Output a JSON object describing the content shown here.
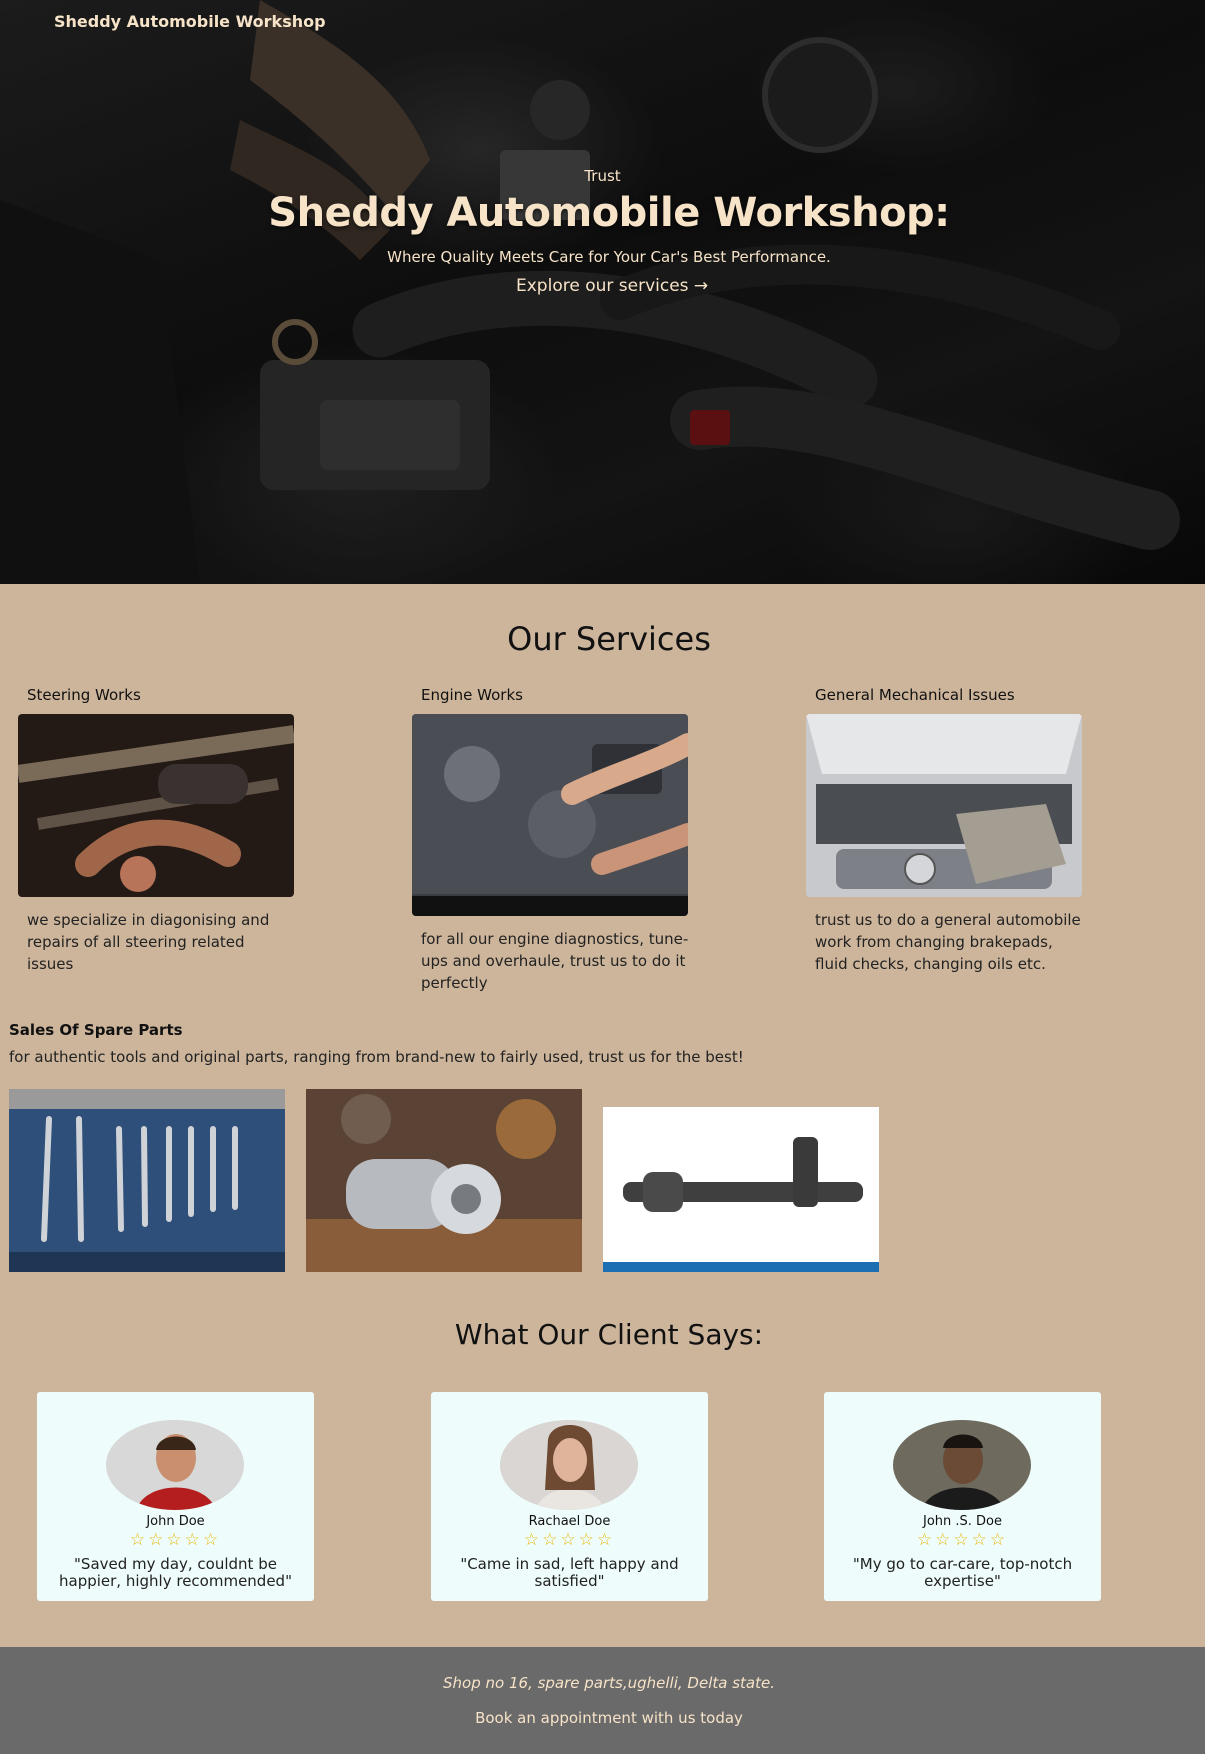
{
  "header": {
    "brand": "Sheddy Automobile Workshop"
  },
  "hero": {
    "eyebrow": "Trust",
    "title": "Sheddy Automobile Workshop:",
    "subtitle": "Where Quality Meets Care for Your Car's Best Performance.",
    "cta": "Explore our services →"
  },
  "services": {
    "title": "Our Services",
    "items": [
      {
        "title": "Steering Works",
        "text": "we specialize in diagonising and repairs of all steering related issues"
      },
      {
        "title": "Engine Works",
        "text": "for all our engine diagnostics, tune-ups and overhaule, trust us to do it perfectly"
      },
      {
        "title": "General Mechanical Issues",
        "text": "trust us to do a general automobile work from changing brakepads, fluid checks, changing oils etc."
      }
    ]
  },
  "spare_parts": {
    "title": "Sales Of Spare Parts",
    "text": "for authentic tools and original parts, ranging from brand-new to fairly used, trust us for the best!"
  },
  "testimonials": {
    "title": "What Our Client Says:",
    "items": [
      {
        "name": "John Doe",
        "stars": "☆☆☆☆☆",
        "quote": "\"Saved my day, couldnt be happier, highly recommended\""
      },
      {
        "name": "Rachael Doe",
        "stars": "☆☆☆☆☆",
        "quote": "\"Came in sad, left happy and satisfied\""
      },
      {
        "name": "John .S. Doe",
        "stars": "☆☆☆☆☆",
        "quote": "\"My go to car-care, top-notch expertise\""
      }
    ]
  },
  "footer": {
    "address": "Shop no 16, spare parts,ughelli, Delta state.",
    "booking": "Book an appointment with us today"
  },
  "colors": {
    "page_bg": "#cdb59b",
    "hero_text": "#f6e3c8",
    "card_bg": "#eefcfb",
    "star": "#e8b90c",
    "footer_bg": "#6a6a6a"
  }
}
